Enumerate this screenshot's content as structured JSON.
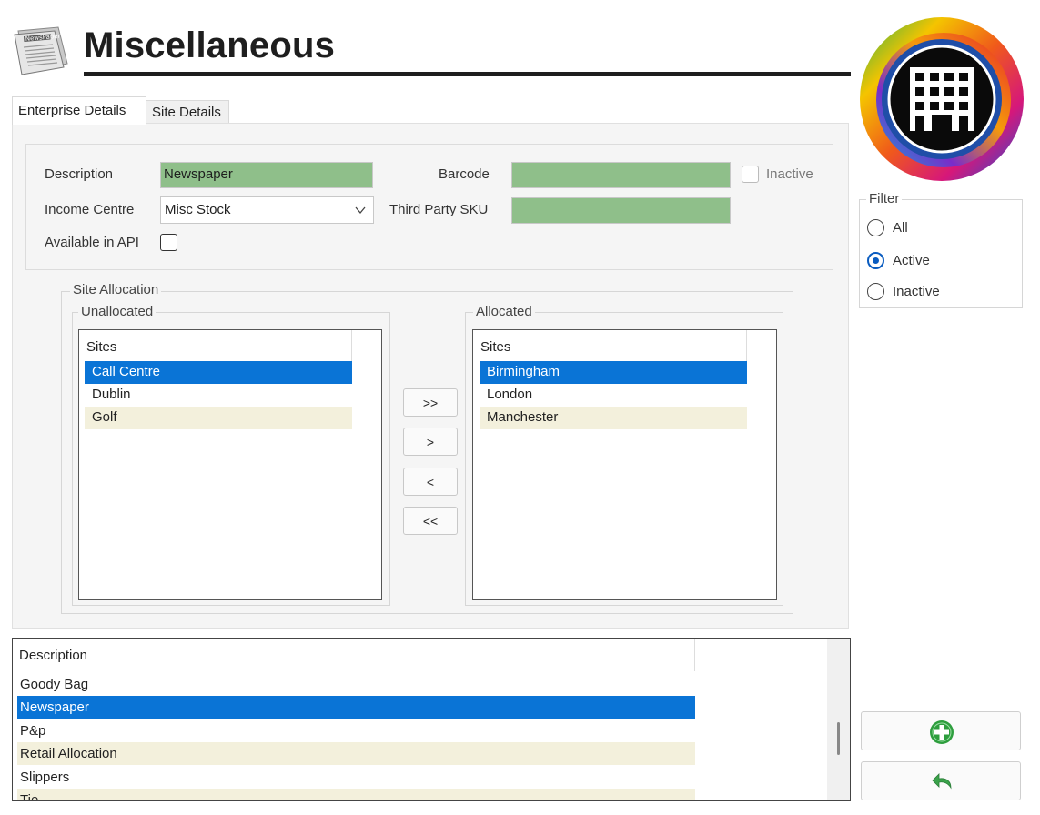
{
  "header": {
    "title": "Miscellaneous",
    "icon": "newspaper-icon",
    "logo": "enterprise-building-logo",
    "icon_text": "NewsPaper"
  },
  "tabs": [
    {
      "label": "Enterprise Details",
      "active": true
    },
    {
      "label": "Site Details",
      "active": false
    }
  ],
  "form": {
    "description_label": "Description",
    "description_value": "Newspaper",
    "income_centre_label": "Income Centre",
    "income_centre_value": "Misc Stock",
    "available_api_label": "Available in API",
    "available_api_checked": false,
    "barcode_label": "Barcode",
    "barcode_value": "",
    "third_party_sku_label": "Third Party SKU",
    "third_party_sku_value": "",
    "inactive_label": "Inactive",
    "inactive_checked": false,
    "field_color": "#8fbf8a"
  },
  "site_allocation": {
    "title": "Site Allocation",
    "unallocated": {
      "title": "Unallocated",
      "column": "Sites",
      "items": [
        "Call Centre",
        "Dublin",
        "Golf"
      ],
      "selected": 0
    },
    "allocated": {
      "title": "Allocated",
      "column": "Sites",
      "items": [
        "Birmingham",
        "London",
        "Manchester"
      ],
      "selected": 0
    },
    "buttons": {
      "move_all_right": ">>",
      "move_right": ">",
      "move_left": "<",
      "move_all_left": "<<"
    }
  },
  "filter": {
    "title": "Filter",
    "options": [
      "All",
      "Active",
      "Inactive"
    ],
    "selected": "Active"
  },
  "grid": {
    "column": "Description",
    "rows": [
      "Goody Bag",
      "Newspaper",
      "P&p",
      "Retail Allocation",
      "Slippers",
      "Tie"
    ],
    "selected": 1
  },
  "actions": {
    "add_icon": "plus-circle-icon",
    "undo_icon": "undo-icon"
  },
  "colors": {
    "selection": "#0a74d6",
    "alt_row": "#f3f0dc",
    "radio_accent": "#0a5cc0",
    "add_green": "#2e9e3e"
  }
}
